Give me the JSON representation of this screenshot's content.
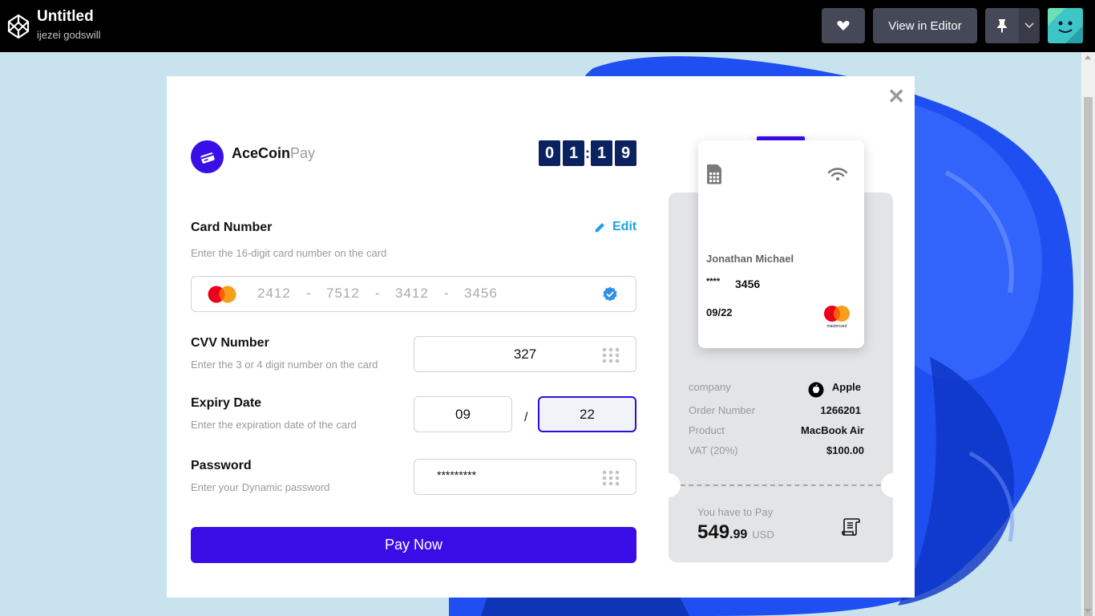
{
  "header": {
    "title": "Untitled",
    "author": "ijezei godswill",
    "view_editor_label": "View in Editor"
  },
  "brand": {
    "name_bold": "AceCoin",
    "name_light": "Pay"
  },
  "timer": {
    "d1": "0",
    "d2": "1",
    "d3": "1",
    "d4": "9"
  },
  "card_number": {
    "label": "Card Number",
    "hint": "Enter the 16-digit card number on the card",
    "edit_label": "Edit",
    "seg1": "2412",
    "seg2": "7512",
    "seg3": "3412",
    "seg4": "3456",
    "separator": "-"
  },
  "cvv": {
    "label": "CVV Number",
    "hint": "Enter the 3 or 4 digit number on the card",
    "value": "327"
  },
  "expiry": {
    "label": "Expiry Date",
    "hint": "Enter the expiration date of the card",
    "month": "09",
    "separator": "/",
    "year": "22"
  },
  "password": {
    "label": "Password",
    "hint": "Enter your Dynamic password",
    "value": "*********"
  },
  "pay_button": {
    "label": "Pay Now"
  },
  "card_preview": {
    "holder": "Jonathan Michael",
    "stars": "****",
    "last4": "3456",
    "expiry": "09/22",
    "brand_text": "mastercard"
  },
  "summary": {
    "company_label": "company",
    "company_value": "Apple",
    "order_label": "Order Number",
    "order_value": "1266201",
    "product_label": "Product",
    "product_value": "MacBook Air",
    "vat_label": "VAT (20%)",
    "vat_value": "$100.00",
    "pay_label": "You have to Pay",
    "amount_main": "549",
    "amount_cents": ".99",
    "currency": "USD"
  },
  "colors": {
    "accent": "#3b0de6",
    "timer": "#0b2260",
    "edit": "#1ea1e5"
  }
}
